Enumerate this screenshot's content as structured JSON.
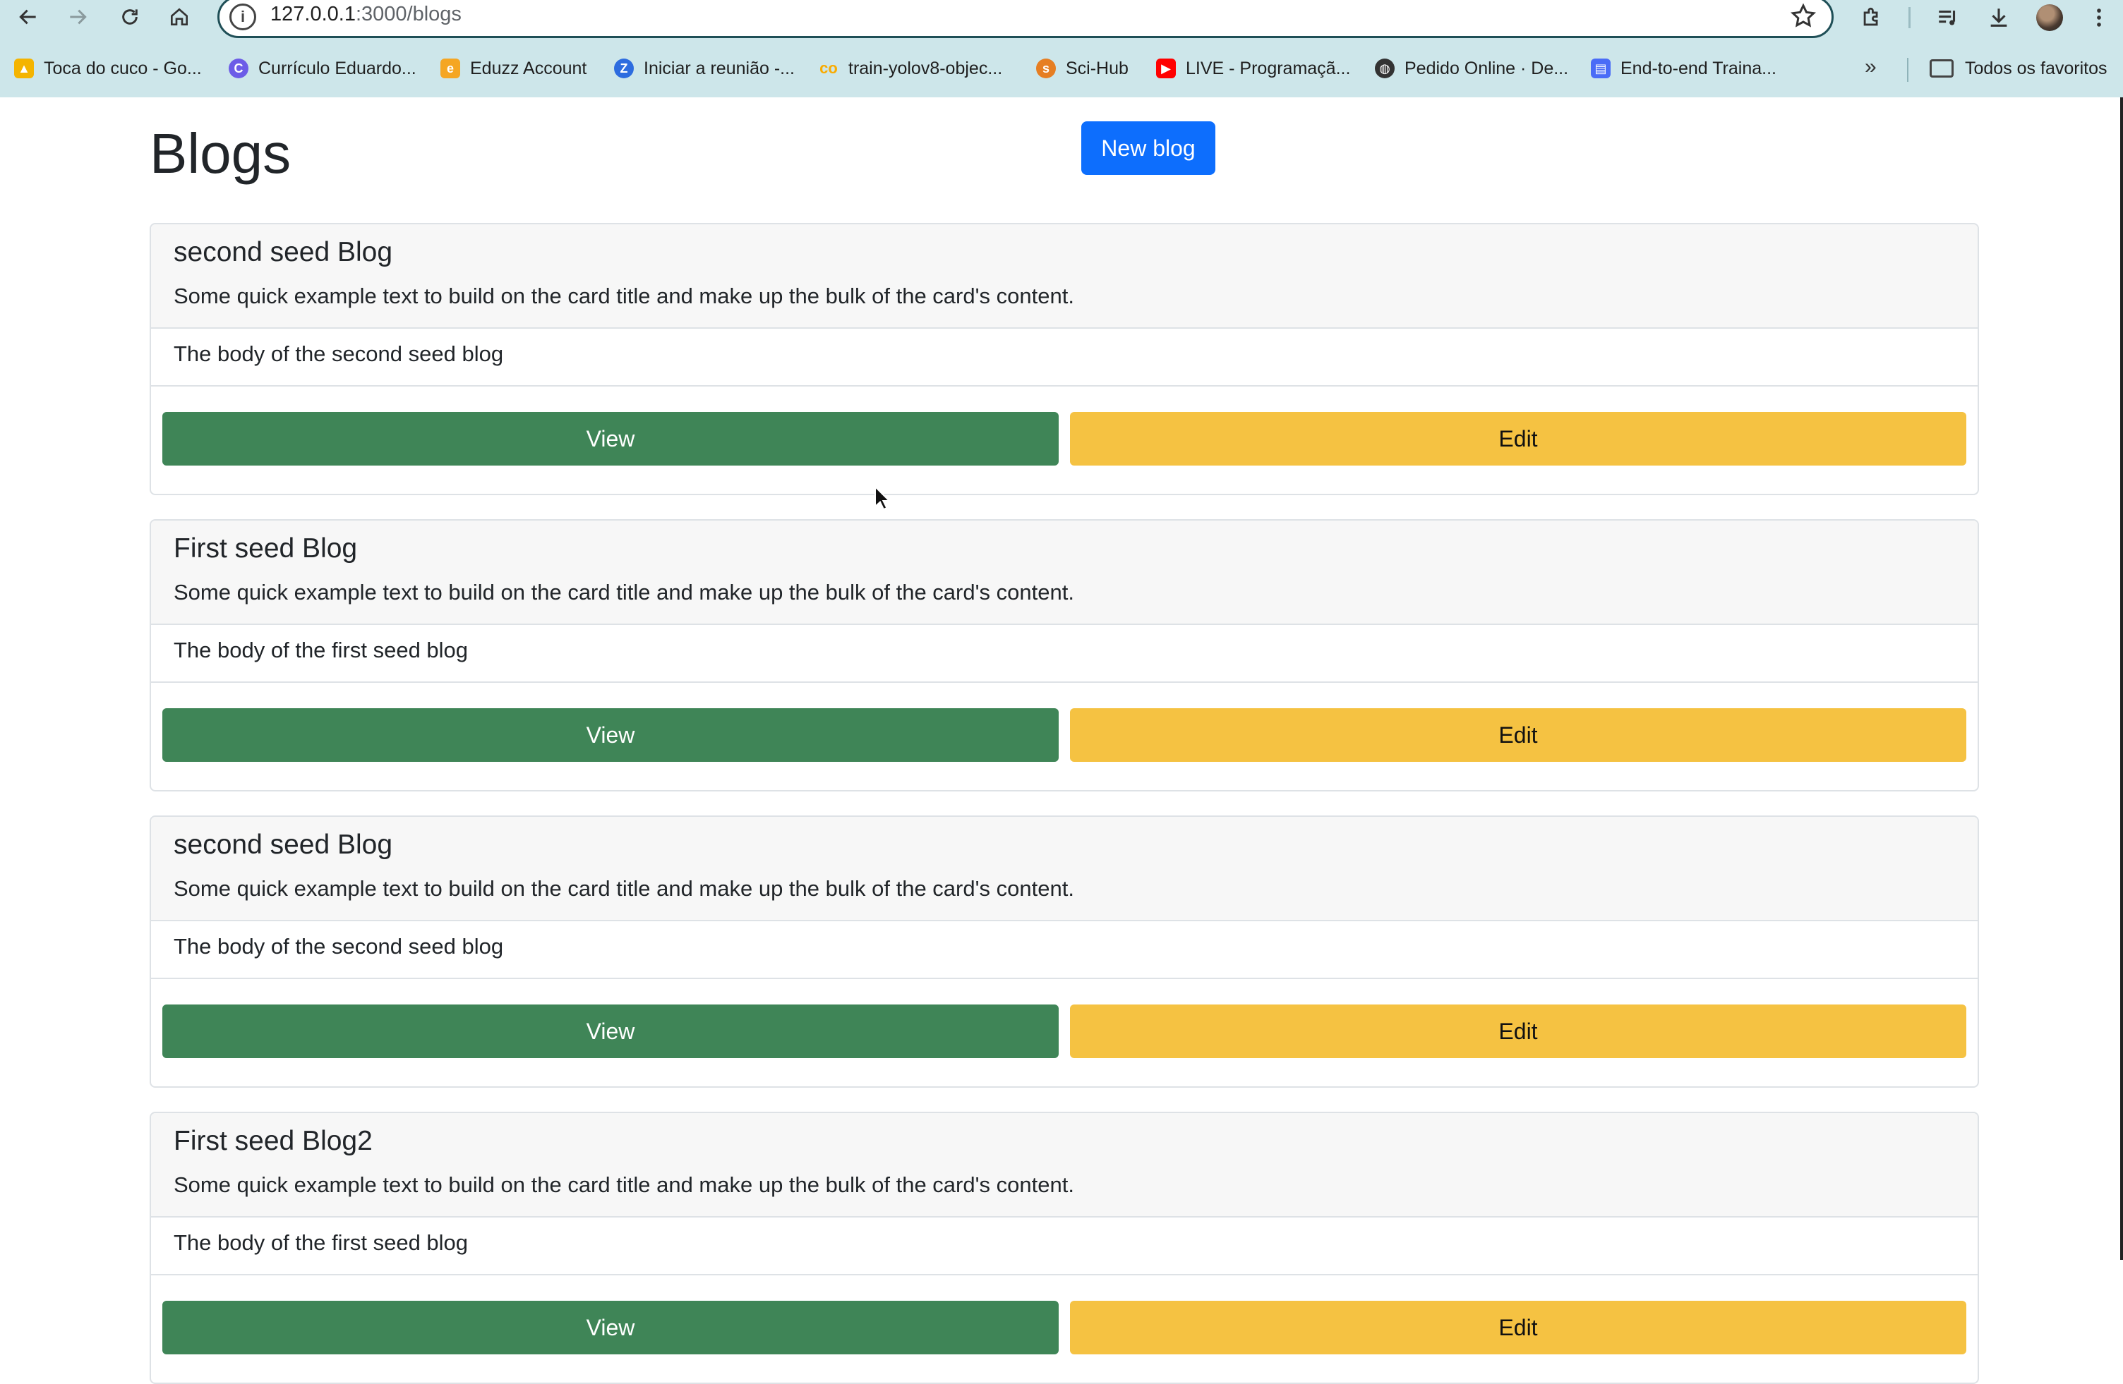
{
  "browser": {
    "url_host": "127.0.0.1",
    "url_path": ":3000/blogs",
    "bookmarks": [
      {
        "label": "Toca do cuco - Go...",
        "color": "#f4b400"
      },
      {
        "label": "Currículo Eduardo...",
        "color": "#6c5ce7"
      },
      {
        "label": "Eduzz Account",
        "color": "#f5a623"
      },
      {
        "label": "Iniciar a reunião -...",
        "color": "#2d6cdf"
      },
      {
        "label": "train-yolov8-objec...",
        "color": "#f9ab00"
      },
      {
        "label": "Sci-Hub",
        "color": "#e67e22"
      },
      {
        "label": "LIVE - Programaçã...",
        "color": "#ff0000"
      },
      {
        "label": "Pedido Online · De...",
        "color": "#333333"
      },
      {
        "label": "End-to-end Traina...",
        "color": "#4a6cf7"
      }
    ],
    "bookmarks_more": "»",
    "all_favorites": "Todos os favoritos"
  },
  "page": {
    "title": "Blogs",
    "new_blog_label": "New blog",
    "colors": {
      "primary": "#0d6efd",
      "view": "#3f8557",
      "edit": "#f5c242"
    }
  },
  "blogs": [
    {
      "title": "second seed Blog",
      "subtitle": "Some quick example text to build on the card title and make up the bulk of the card's content.",
      "body": "The body of the second seed blog",
      "view_label": "View",
      "edit_label": "Edit"
    },
    {
      "title": "First seed Blog",
      "subtitle": "Some quick example text to build on the card title and make up the bulk of the card's content.",
      "body": "The body of the first seed blog",
      "view_label": "View",
      "edit_label": "Edit"
    },
    {
      "title": "second seed Blog",
      "subtitle": "Some quick example text to build on the card title and make up the bulk of the card's content.",
      "body": "The body of the second seed blog",
      "view_label": "View",
      "edit_label": "Edit"
    },
    {
      "title": "First seed Blog2",
      "subtitle": "Some quick example text to build on the card title and make up the bulk of the card's content.",
      "body": "The body of the first seed blog",
      "view_label": "View",
      "edit_label": "Edit"
    }
  ]
}
